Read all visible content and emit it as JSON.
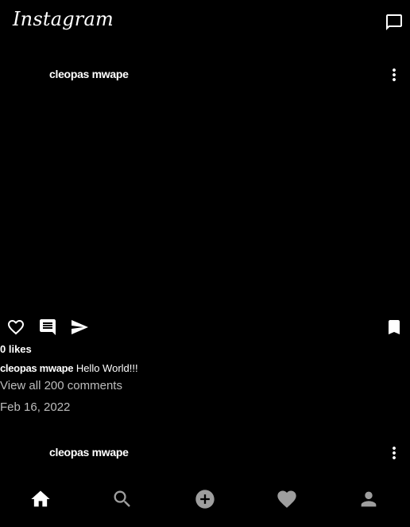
{
  "app": {
    "title": "Instagram"
  },
  "icons": {
    "messages": "message-square-icon",
    "more": "more-vertical-icon",
    "like": "heart-outline-icon",
    "comment": "comment-icon",
    "share": "send-icon",
    "save": "bookmark-icon"
  },
  "posts": [
    {
      "author": "cleopas mwape",
      "likes": "0 likes",
      "caption_user": "cleopas mwape",
      "caption_text": " Hello World!!!",
      "comments_link": "View all 200 comments",
      "date": "Feb 16, 2022"
    },
    {
      "author": "cleopas mwape"
    }
  ],
  "bottom_nav": [
    {
      "name": "home",
      "icon": "home-icon",
      "active": true
    },
    {
      "name": "search",
      "icon": "search-icon",
      "active": false
    },
    {
      "name": "create",
      "icon": "add-circle-icon",
      "active": false
    },
    {
      "name": "activity",
      "icon": "heart-icon",
      "active": false
    },
    {
      "name": "profile",
      "icon": "person-icon",
      "active": false
    }
  ],
  "colors": {
    "background": "#000000",
    "text": "#ffffff",
    "secondary_text": "#bdbdbd",
    "inactive_icon": "#9e9e9e"
  }
}
